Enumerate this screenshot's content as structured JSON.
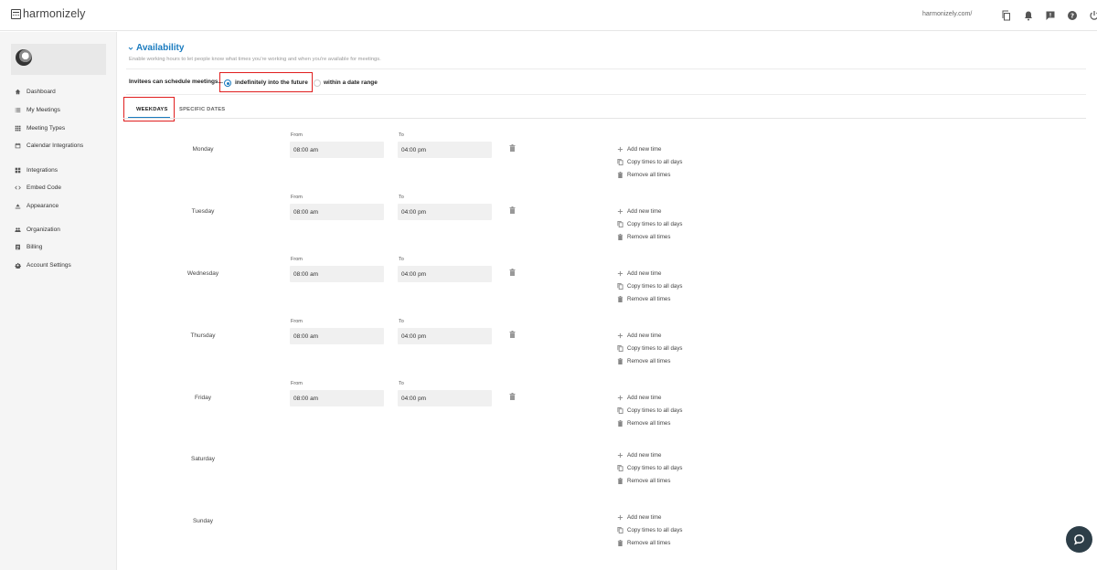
{
  "app": {
    "logo_text": "harmonizely"
  },
  "topbar": {
    "url": "harmonizely.com/",
    "icons": [
      "copy-icon",
      "bell-icon",
      "feedback-icon",
      "help-icon",
      "power-icon"
    ]
  },
  "sidebar": {
    "items": [
      {
        "label": "Dashboard",
        "icon": "home-icon"
      },
      {
        "label": "My Meetings",
        "icon": "list-icon"
      },
      {
        "label": "Meeting Types",
        "icon": "grid-icon"
      },
      {
        "label": "Calendar Integrations",
        "icon": "calendar-icon"
      },
      {
        "label": "Integrations",
        "icon": "widgets-icon"
      },
      {
        "label": "Embed Code",
        "icon": "code-icon"
      },
      {
        "label": "Appearance",
        "icon": "paint-icon"
      },
      {
        "label": "Organization",
        "icon": "people-icon"
      },
      {
        "label": "Billing",
        "icon": "billing-icon"
      },
      {
        "label": "Account Settings",
        "icon": "gear-icon"
      }
    ]
  },
  "availability": {
    "title": "Availability",
    "description": "Enable working hours to let people know what times you're working and when you're available for meetings.",
    "schedule_label": "Invitees can schedule meetings...",
    "options": [
      {
        "label": "indefinitely into the future",
        "selected": true
      },
      {
        "label": "within a date range",
        "selected": false
      }
    ],
    "tabs": [
      {
        "label": "WEEKDAYS",
        "active": true
      },
      {
        "label": "SPECIFIC DATES",
        "active": false
      }
    ],
    "from_label": "From",
    "to_label": "To",
    "actions": {
      "add": "Add new time",
      "copy": "Copy times to all days",
      "remove": "Remove all times"
    },
    "days": [
      {
        "name": "Monday",
        "from": "08:00 am",
        "to": "04:00 pm"
      },
      {
        "name": "Tuesday",
        "from": "08:00 am",
        "to": "04:00 pm"
      },
      {
        "name": "Wednesday",
        "from": "08:00 am",
        "to": "04:00 pm"
      },
      {
        "name": "Thursday",
        "from": "08:00 am",
        "to": "04:00 pm"
      },
      {
        "name": "Friday",
        "from": "08:00 am",
        "to": "04:00 pm"
      },
      {
        "name": "Saturday",
        "from": null,
        "to": null
      },
      {
        "name": "Sunday",
        "from": null,
        "to": null
      }
    ]
  },
  "colors": {
    "accent": "#1a7bbf",
    "highlight": "#e01e1e",
    "chat": "#2d3e48"
  }
}
